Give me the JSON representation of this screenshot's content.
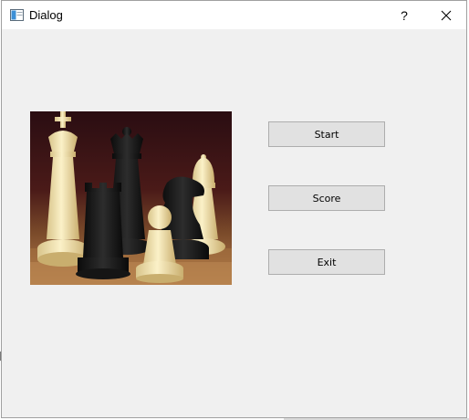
{
  "window": {
    "title": "Dialog",
    "icon": "window-app-icon",
    "help_label": "?",
    "close_icon": "close-icon"
  },
  "image": {
    "subject": "chess-pieces-photo"
  },
  "buttons": {
    "start": "Start",
    "score": "Score",
    "exit": "Exit"
  },
  "colors": {
    "dialog_background": "#f0f0f0",
    "titlebar_background": "#ffffff",
    "button_face": "#e1e1e1",
    "button_border": "#adadad"
  }
}
